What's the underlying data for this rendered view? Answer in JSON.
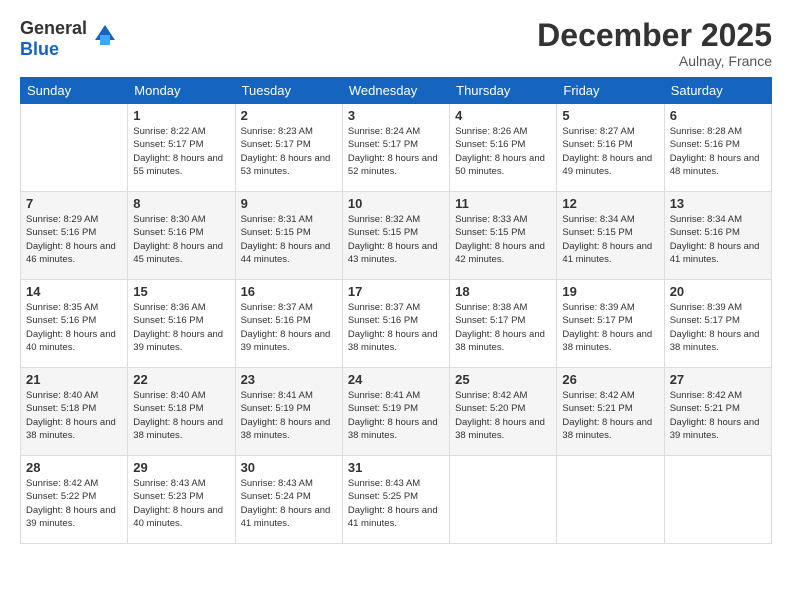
{
  "header": {
    "logo_general": "General",
    "logo_blue": "Blue",
    "month_title": "December 2025",
    "location": "Aulnay, France"
  },
  "days_of_week": [
    "Sunday",
    "Monday",
    "Tuesday",
    "Wednesday",
    "Thursday",
    "Friday",
    "Saturday"
  ],
  "weeks": [
    [
      {
        "day": "",
        "sunrise": "",
        "sunset": "",
        "daylight": ""
      },
      {
        "day": "1",
        "sunrise": "Sunrise: 8:22 AM",
        "sunset": "Sunset: 5:17 PM",
        "daylight": "Daylight: 8 hours and 55 minutes."
      },
      {
        "day": "2",
        "sunrise": "Sunrise: 8:23 AM",
        "sunset": "Sunset: 5:17 PM",
        "daylight": "Daylight: 8 hours and 53 minutes."
      },
      {
        "day": "3",
        "sunrise": "Sunrise: 8:24 AM",
        "sunset": "Sunset: 5:17 PM",
        "daylight": "Daylight: 8 hours and 52 minutes."
      },
      {
        "day": "4",
        "sunrise": "Sunrise: 8:26 AM",
        "sunset": "Sunset: 5:16 PM",
        "daylight": "Daylight: 8 hours and 50 minutes."
      },
      {
        "day": "5",
        "sunrise": "Sunrise: 8:27 AM",
        "sunset": "Sunset: 5:16 PM",
        "daylight": "Daylight: 8 hours and 49 minutes."
      },
      {
        "day": "6",
        "sunrise": "Sunrise: 8:28 AM",
        "sunset": "Sunset: 5:16 PM",
        "daylight": "Daylight: 8 hours and 48 minutes."
      }
    ],
    [
      {
        "day": "7",
        "sunrise": "Sunrise: 8:29 AM",
        "sunset": "Sunset: 5:16 PM",
        "daylight": "Daylight: 8 hours and 46 minutes."
      },
      {
        "day": "8",
        "sunrise": "Sunrise: 8:30 AM",
        "sunset": "Sunset: 5:16 PM",
        "daylight": "Daylight: 8 hours and 45 minutes."
      },
      {
        "day": "9",
        "sunrise": "Sunrise: 8:31 AM",
        "sunset": "Sunset: 5:15 PM",
        "daylight": "Daylight: 8 hours and 44 minutes."
      },
      {
        "day": "10",
        "sunrise": "Sunrise: 8:32 AM",
        "sunset": "Sunset: 5:15 PM",
        "daylight": "Daylight: 8 hours and 43 minutes."
      },
      {
        "day": "11",
        "sunrise": "Sunrise: 8:33 AM",
        "sunset": "Sunset: 5:15 PM",
        "daylight": "Daylight: 8 hours and 42 minutes."
      },
      {
        "day": "12",
        "sunrise": "Sunrise: 8:34 AM",
        "sunset": "Sunset: 5:15 PM",
        "daylight": "Daylight: 8 hours and 41 minutes."
      },
      {
        "day": "13",
        "sunrise": "Sunrise: 8:34 AM",
        "sunset": "Sunset: 5:16 PM",
        "daylight": "Daylight: 8 hours and 41 minutes."
      }
    ],
    [
      {
        "day": "14",
        "sunrise": "Sunrise: 8:35 AM",
        "sunset": "Sunset: 5:16 PM",
        "daylight": "Daylight: 8 hours and 40 minutes."
      },
      {
        "day": "15",
        "sunrise": "Sunrise: 8:36 AM",
        "sunset": "Sunset: 5:16 PM",
        "daylight": "Daylight: 8 hours and 39 minutes."
      },
      {
        "day": "16",
        "sunrise": "Sunrise: 8:37 AM",
        "sunset": "Sunset: 5:16 PM",
        "daylight": "Daylight: 8 hours and 39 minutes."
      },
      {
        "day": "17",
        "sunrise": "Sunrise: 8:37 AM",
        "sunset": "Sunset: 5:16 PM",
        "daylight": "Daylight: 8 hours and 38 minutes."
      },
      {
        "day": "18",
        "sunrise": "Sunrise: 8:38 AM",
        "sunset": "Sunset: 5:17 PM",
        "daylight": "Daylight: 8 hours and 38 minutes."
      },
      {
        "day": "19",
        "sunrise": "Sunrise: 8:39 AM",
        "sunset": "Sunset: 5:17 PM",
        "daylight": "Daylight: 8 hours and 38 minutes."
      },
      {
        "day": "20",
        "sunrise": "Sunrise: 8:39 AM",
        "sunset": "Sunset: 5:17 PM",
        "daylight": "Daylight: 8 hours and 38 minutes."
      }
    ],
    [
      {
        "day": "21",
        "sunrise": "Sunrise: 8:40 AM",
        "sunset": "Sunset: 5:18 PM",
        "daylight": "Daylight: 8 hours and 38 minutes."
      },
      {
        "day": "22",
        "sunrise": "Sunrise: 8:40 AM",
        "sunset": "Sunset: 5:18 PM",
        "daylight": "Daylight: 8 hours and 38 minutes."
      },
      {
        "day": "23",
        "sunrise": "Sunrise: 8:41 AM",
        "sunset": "Sunset: 5:19 PM",
        "daylight": "Daylight: 8 hours and 38 minutes."
      },
      {
        "day": "24",
        "sunrise": "Sunrise: 8:41 AM",
        "sunset": "Sunset: 5:19 PM",
        "daylight": "Daylight: 8 hours and 38 minutes."
      },
      {
        "day": "25",
        "sunrise": "Sunrise: 8:42 AM",
        "sunset": "Sunset: 5:20 PM",
        "daylight": "Daylight: 8 hours and 38 minutes."
      },
      {
        "day": "26",
        "sunrise": "Sunrise: 8:42 AM",
        "sunset": "Sunset: 5:21 PM",
        "daylight": "Daylight: 8 hours and 38 minutes."
      },
      {
        "day": "27",
        "sunrise": "Sunrise: 8:42 AM",
        "sunset": "Sunset: 5:21 PM",
        "daylight": "Daylight: 8 hours and 39 minutes."
      }
    ],
    [
      {
        "day": "28",
        "sunrise": "Sunrise: 8:42 AM",
        "sunset": "Sunset: 5:22 PM",
        "daylight": "Daylight: 8 hours and 39 minutes."
      },
      {
        "day": "29",
        "sunrise": "Sunrise: 8:43 AM",
        "sunset": "Sunset: 5:23 PM",
        "daylight": "Daylight: 8 hours and 40 minutes."
      },
      {
        "day": "30",
        "sunrise": "Sunrise: 8:43 AM",
        "sunset": "Sunset: 5:24 PM",
        "daylight": "Daylight: 8 hours and 41 minutes."
      },
      {
        "day": "31",
        "sunrise": "Sunrise: 8:43 AM",
        "sunset": "Sunset: 5:25 PM",
        "daylight": "Daylight: 8 hours and 41 minutes."
      },
      {
        "day": "",
        "sunrise": "",
        "sunset": "",
        "daylight": ""
      },
      {
        "day": "",
        "sunrise": "",
        "sunset": "",
        "daylight": ""
      },
      {
        "day": "",
        "sunrise": "",
        "sunset": "",
        "daylight": ""
      }
    ]
  ]
}
